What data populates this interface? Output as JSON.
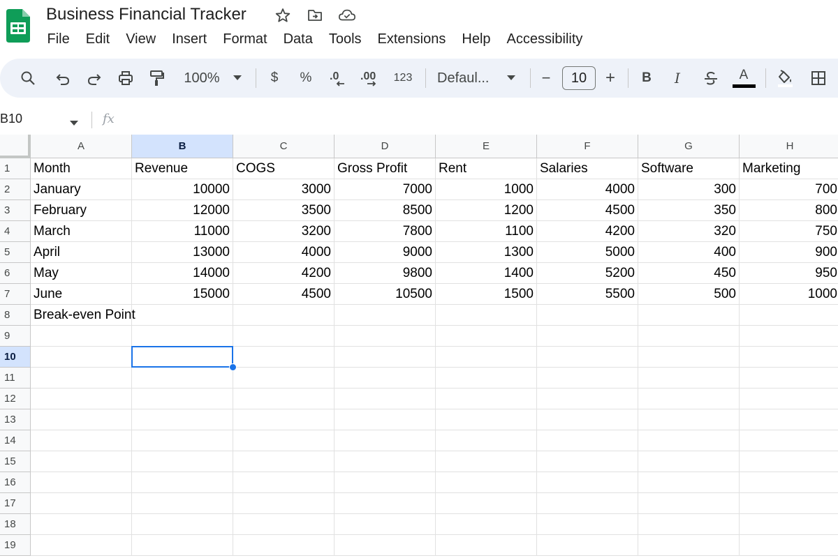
{
  "app": {
    "title": "Business Financial Tracker",
    "accent": "#1a73e8",
    "icons": [
      "sheets-logo-icon",
      "star-icon",
      "move-to-folder-icon",
      "cloud-saved-icon"
    ]
  },
  "menu": [
    "File",
    "Edit",
    "View",
    "Insert",
    "Format",
    "Data",
    "Tools",
    "Extensions",
    "Help",
    "Accessibility"
  ],
  "toolbar": {
    "zoom": "100%",
    "currency": "$",
    "percent": "%",
    "decrease_decimal": ".0",
    "increase_decimal": ".00",
    "number_format": "123",
    "font": "Defaul...",
    "font_size": "10",
    "minus": "−",
    "plus": "+",
    "bold": "B",
    "italic": "I",
    "text_color_glyph": "A",
    "icons": [
      "search-icon",
      "undo-icon",
      "redo-icon",
      "print-icon",
      "paint-format-icon",
      "chevron-down-icon",
      "strikethrough-icon",
      "text-color-icon",
      "fill-color-icon",
      "borders-icon"
    ]
  },
  "formula_bar": {
    "name_box": "B10",
    "fx": "fx",
    "content": ""
  },
  "sheet": {
    "selected_cell": "B10",
    "selected_column": "B",
    "selected_row": "10",
    "columns": [
      "A",
      "B",
      "C",
      "D",
      "E",
      "F",
      "G",
      "H"
    ],
    "row_numbers": [
      "1",
      "2",
      "3",
      "4",
      "5",
      "6",
      "7",
      "8",
      "9",
      "10",
      "11",
      "12",
      "13",
      "14",
      "15",
      "16",
      "17",
      "18",
      "19"
    ],
    "rows": [
      [
        "Month",
        "Revenue",
        "COGS",
        "Gross Profit",
        "Rent",
        "Salaries",
        "Software",
        "Marketing"
      ],
      [
        "January",
        "10000",
        "3000",
        "7000",
        "1000",
        "4000",
        "300",
        "700"
      ],
      [
        "February",
        "12000",
        "3500",
        "8500",
        "1200",
        "4500",
        "350",
        "800"
      ],
      [
        "March",
        "11000",
        "3200",
        "7800",
        "1100",
        "4200",
        "320",
        "750"
      ],
      [
        "April",
        "13000",
        "4000",
        "9000",
        "1300",
        "5000",
        "400",
        "900"
      ],
      [
        "May",
        "14000",
        "4200",
        "9800",
        "1400",
        "5200",
        "450",
        "950"
      ],
      [
        "June",
        "15000",
        "4500",
        "10500",
        "1500",
        "5500",
        "500",
        "1000"
      ],
      [
        "Break-even Point",
        "",
        "",
        "",
        "",
        "",
        "",
        ""
      ]
    ]
  }
}
